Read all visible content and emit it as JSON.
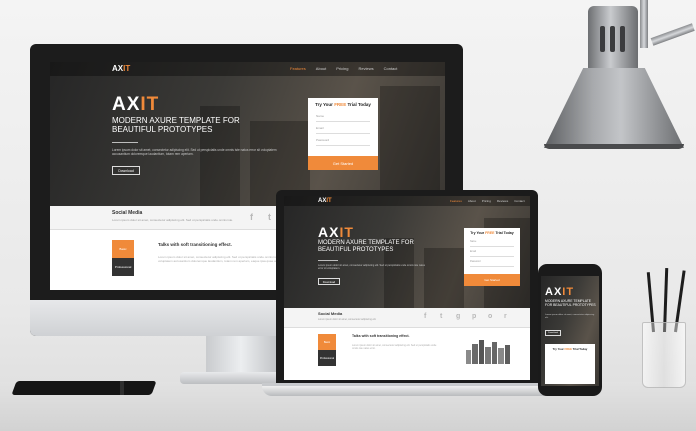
{
  "monitor": {
    "site": {
      "logo_ax": "AX",
      "logo_it": "IT",
      "nav": [
        "Features",
        "About",
        "Pricing",
        "Reviews",
        "Contact"
      ],
      "hero_ax": "AX",
      "hero_it": "IT",
      "subtitle": "MODERN AXURE TEMPLATE FOR BEAUTIFUL PROTOTYPES",
      "lorem": "Lorem ipsum dolor sit amet, consectetur adipiscing elit. Sed ut perspiciatis unde omnis iste natus error sit voluptatem accusantium doloremque laudantium, totam rem aperiam.",
      "download": "Download",
      "form_title_pre": "Try Your ",
      "form_title_free": "FREE",
      "form_title_post": " Trial Today",
      "field_name": "Name",
      "field_email": "Email",
      "field_password": "Password",
      "get_started": "Get Started",
      "social_title": "Social Media",
      "social_text": "Lorem ipsum dolor sit amet, consectetur adipiscing elit. Sed ut perspiciatis unde omnis iste.",
      "box_orange": "Basic",
      "box_dark": "Professional",
      "talk": "Talks with soft transitioning effect.",
      "lower_lorem": "Lorem ipsum dolor sit amet, consectetur adipiscing elit. Sed ut perspiciatis unde omnis iste natus error sit voluptatem accusantium doloremque laudantium, totam rem aperiam, eaque ipsa quae ab illo inventore."
    }
  },
  "laptop": {
    "site": {
      "logo_ax": "AX",
      "logo_it": "IT",
      "nav": [
        "Features",
        "About",
        "Pricing",
        "Reviews",
        "Contact"
      ],
      "hero_ax": "AX",
      "hero_it": "IT",
      "subtitle": "MODERN AXURE TEMPLATE FOR BEAUTIFUL PROTOTYPES",
      "lorem": "Lorem ipsum dolor sit amet, consectetur adipiscing elit. Sed ut perspiciatis unde omnis iste natus error sit voluptatem.",
      "download": "Download",
      "form_title_pre": "Try Your ",
      "form_title_free": "FREE",
      "form_title_post": " Trial Today",
      "field_name": "Name",
      "field_email": "Email",
      "field_password": "Password",
      "get_started": "Get Started",
      "social_title": "Social Media",
      "social_text": "Lorem ipsum dolor sit amet, consectetur adipiscing elit.",
      "box_orange": "Basic",
      "box_dark": "Professional",
      "talk": "Talks with soft transitioning effect.",
      "lower_lorem": "Lorem ipsum dolor sit amet, consectetur adipiscing elit. Sed ut perspiciatis unde omnis iste natus error."
    }
  },
  "phone": {
    "site": {
      "hero_ax": "AX",
      "hero_it": "IT",
      "subtitle": "MODERN AXURE TEMPLATE FOR BEAUTIFUL PROTOTYPES",
      "lorem": "Lorem ipsum dolor sit amet, consectetur adipiscing elit.",
      "download": "Download",
      "form_title_pre": "Try Your ",
      "form_title_free": "FREE",
      "form_title_post": " Trial Today"
    }
  },
  "colors": {
    "accent": "#f08a3a",
    "dark": "#1c1c1c"
  }
}
